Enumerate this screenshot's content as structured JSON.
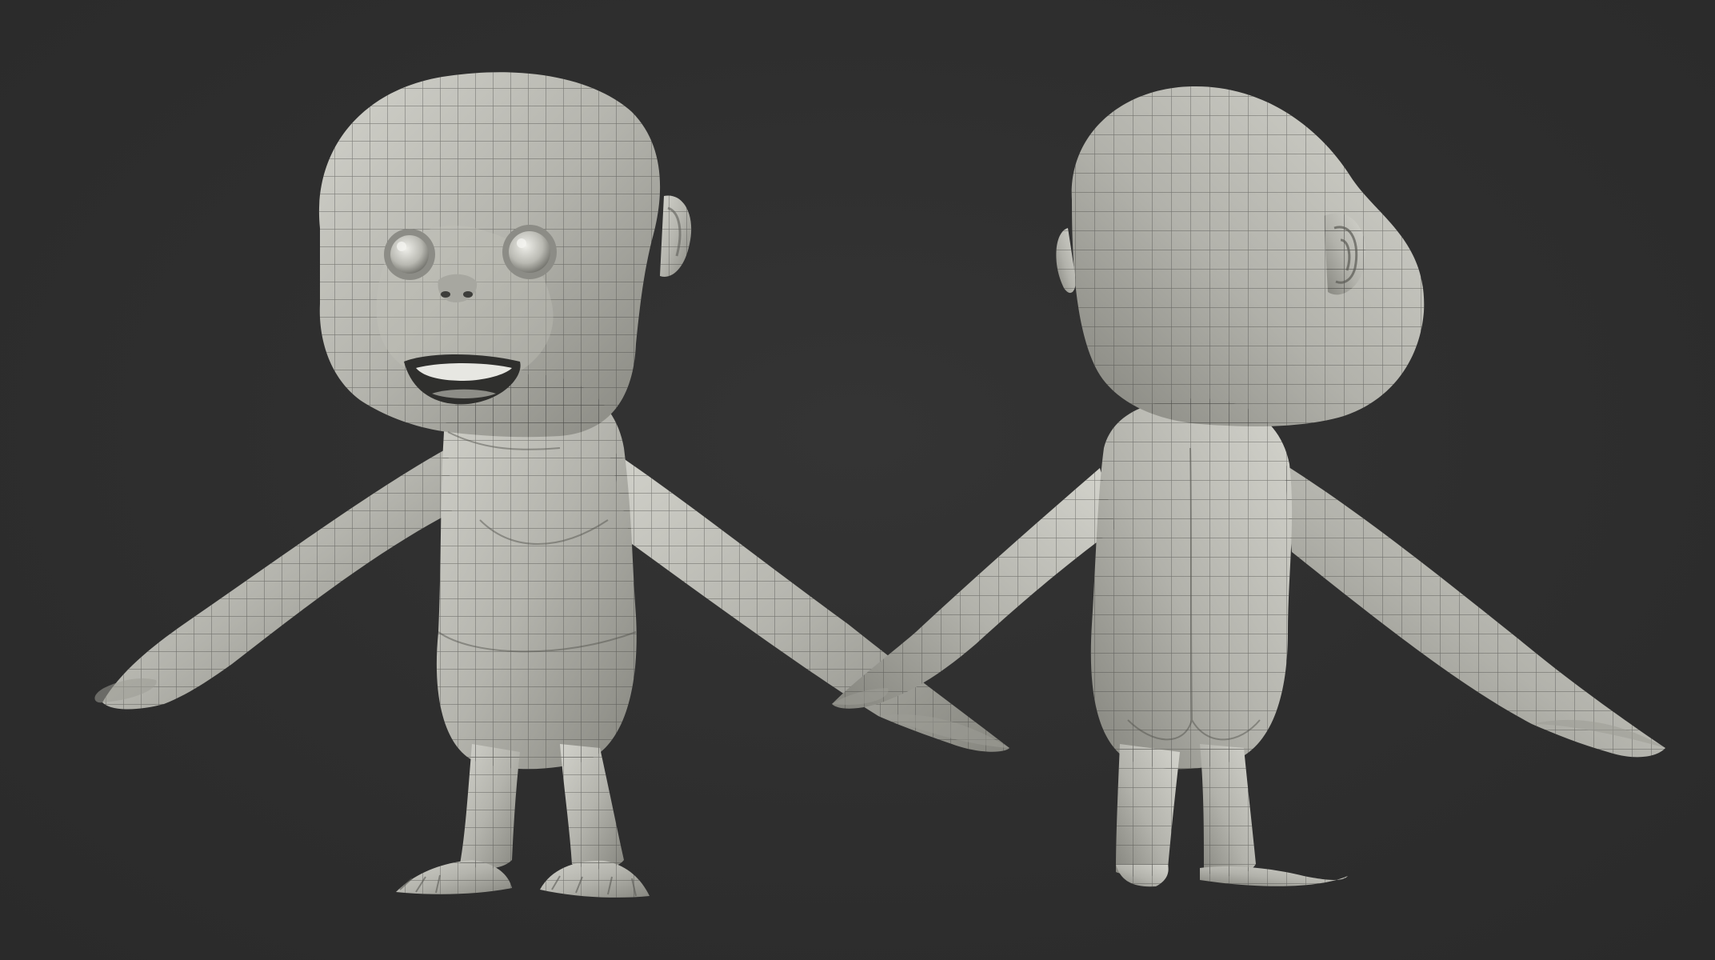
{
  "scene": {
    "background_color": "#2d2d2d",
    "mesh_color": "#b9b9b2",
    "wire_color": "#3c3c3a",
    "views": [
      {
        "name": "front-view"
      },
      {
        "name": "back-view"
      }
    ]
  }
}
